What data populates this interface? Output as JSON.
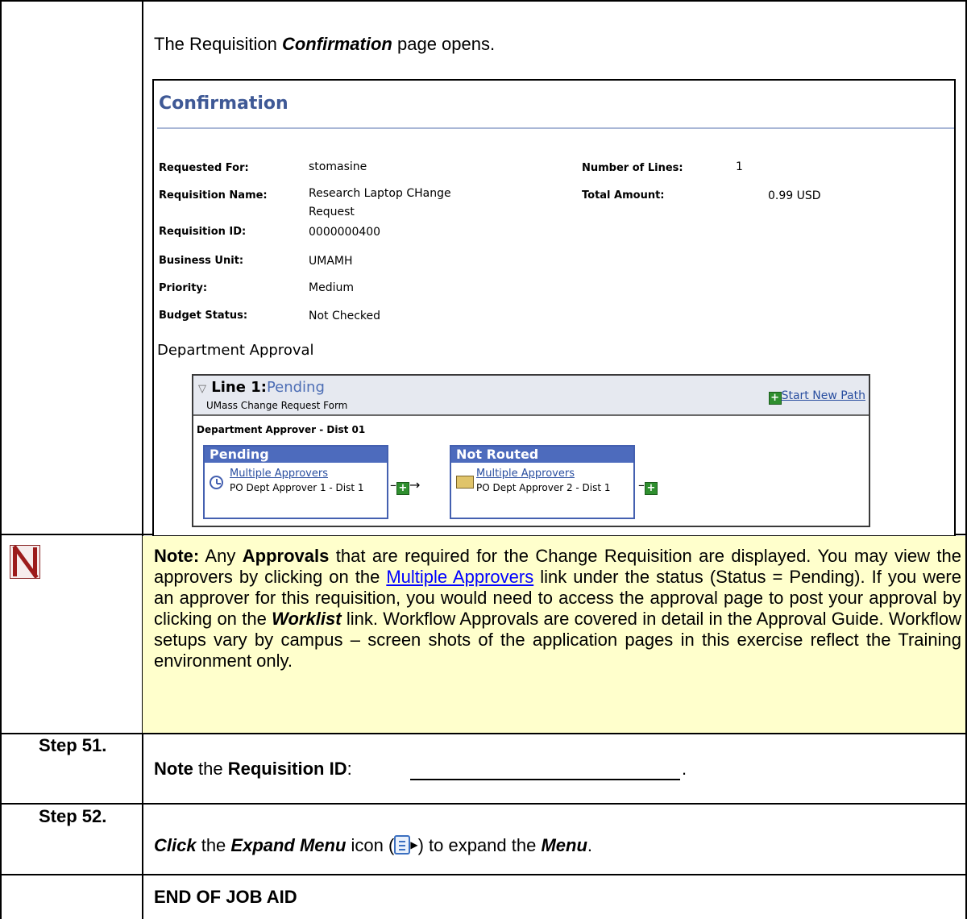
{
  "intro": {
    "text_before": "The Requisition ",
    "emphasis": "Confirmation",
    "text_after": " page opens."
  },
  "confirmation": {
    "title": "Confirmation",
    "fields": {
      "requested_for_label": "Requested For:",
      "requested_for_value": "stomasine",
      "requisition_name_label": "Requisition Name:",
      "requisition_name_value_1": "Research Laptop CHange",
      "requisition_name_value_2": "Request",
      "requisition_id_label": "Requisition ID:",
      "requisition_id_value": "0000000400",
      "business_unit_label": "Business Unit:",
      "business_unit_value": "UMAMH",
      "priority_label": "Priority:",
      "priority_value": "Medium",
      "budget_status_label": "Budget Status:",
      "budget_status_value": "Not Checked",
      "number_of_lines_label": "Number of Lines:",
      "number_of_lines_value": "1",
      "total_amount_label": "Total Amount:",
      "total_amount_value": "0.99",
      "currency": "USD"
    },
    "section_title": "Department Approval",
    "approval": {
      "line_label": "Line 1:",
      "line_status": "Pending",
      "form_name": "UMass Change Request Form",
      "start_new_path": "Start New Path",
      "step_header": "Department Approver - Dist 01",
      "nodes": [
        {
          "status": "Pending",
          "link": "Multiple Approvers",
          "subtitle": "PO Dept Approver 1 - Dist 1"
        },
        {
          "status": "Not Routed",
          "link": "Multiple Approvers",
          "subtitle": "PO Dept Approver 2 - Dist 1"
        }
      ]
    }
  },
  "note": {
    "label": "Note:",
    "t1": "  Any ",
    "approvals_bold": "Approvals",
    "t2": " that are required for the Change Requisition are displayed. You may view the approvers by clicking on the ",
    "link": "Multiple Approvers",
    "t3": " link under the status (Status = Pending).  If you were an approver for this requisition, you would need to access the approval page to post your approval by clicking on the ",
    "worklist": "Worklist",
    "t4": " link.  Workflow Approvals are covered in detail in the Approval Guide.  Workflow setups vary by campus – screen shots of the application pages in this exercise reflect the Training environment only."
  },
  "steps": [
    {
      "label": "Step 51.",
      "verb": "Note",
      "t1": " the ",
      "bold": "Requisition ID",
      "t2": ":",
      "end": "."
    },
    {
      "label": "Step 52.",
      "verb": "Click",
      "t1": " the ",
      "bold": "Expand Menu",
      "t2": " icon (",
      "t3": ") to expand the ",
      "bold2": "Menu",
      "end": "."
    }
  ],
  "end_text": "END OF JOB AID"
}
